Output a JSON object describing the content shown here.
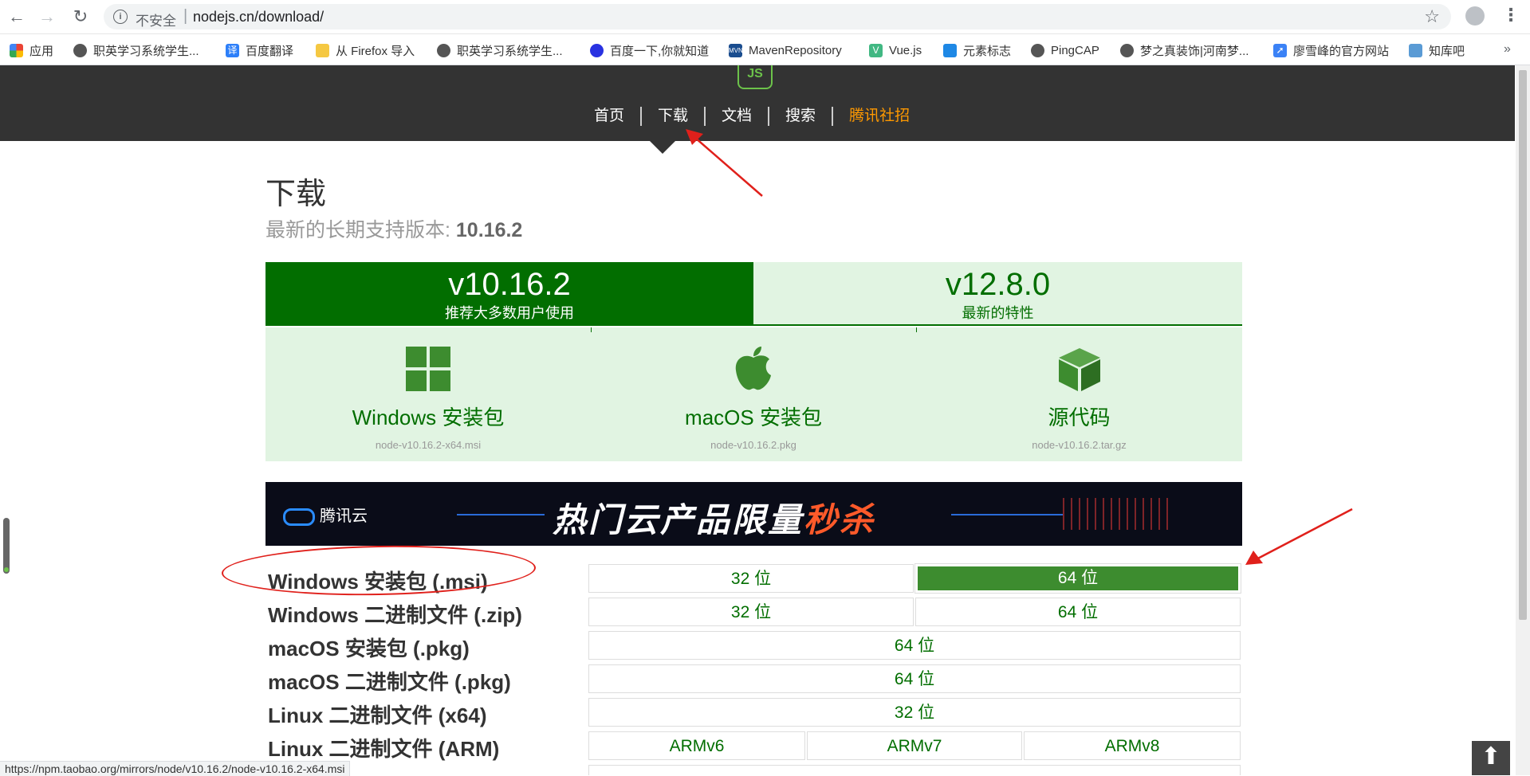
{
  "browser": {
    "insecure_label": "不安全",
    "url": "nodejs.cn/download/",
    "bookmarks": [
      {
        "label": "应用",
        "icon": "apps-grid-icon"
      },
      {
        "label": "职英学习系统学生...",
        "icon": "globe-icon"
      },
      {
        "label": "百度翻译",
        "icon": "translate-icon"
      },
      {
        "label": "从 Firefox 导入",
        "icon": "folder-icon"
      },
      {
        "label": "职英学习系统学生...",
        "icon": "globe-icon"
      },
      {
        "label": "百度一下,你就知道",
        "icon": "baidu-paw-icon"
      },
      {
        "label": "MavenRepository",
        "icon": "mvn-icon"
      },
      {
        "label": "Vue.js",
        "icon": "vue-icon"
      },
      {
        "label": "元素标志",
        "icon": "shield-icon"
      },
      {
        "label": "PingCAP",
        "icon": "globe-icon"
      },
      {
        "label": "梦之真装饰|河南梦...",
        "icon": "globe-icon"
      },
      {
        "label": "廖雪峰的官方网站",
        "icon": "rocket-icon"
      },
      {
        "label": "知库吧",
        "icon": "zhiku-icon"
      }
    ],
    "more_bookmarks": "»",
    "status_url": "https://npm.taobao.org/mirrors/node/v10.16.2/node-v10.16.2-x64.msi"
  },
  "site": {
    "logo_text": "JS",
    "nav": [
      "首页",
      "下载",
      "文档",
      "搜索",
      "腾讯社招"
    ],
    "title": "下载",
    "lts_prefix": "最新的长期支持版本: ",
    "lts_version": "10.16.2",
    "tabs": {
      "lts": {
        "version": "v10.16.2",
        "caption": "推荐大多数用户使用"
      },
      "current": {
        "version": "v12.8.0",
        "caption": "最新的特性"
      }
    },
    "downloads": [
      {
        "label": "Windows 安装包",
        "file": "node-v10.16.2-x64.msi",
        "icon": "windows-icon"
      },
      {
        "label": "macOS 安装包",
        "file": "node-v10.16.2.pkg",
        "icon": "apple-icon"
      },
      {
        "label": "源代码",
        "file": "node-v10.16.2.tar.gz",
        "icon": "box-icon"
      }
    ],
    "banner": {
      "brand": "腾讯云",
      "text_main": "热门云产品限量",
      "text_hot": "秒杀"
    },
    "table": [
      {
        "label": "Windows 安装包 (.msi)",
        "cells": [
          "32 位",
          "64 位"
        ]
      },
      {
        "label": "Windows 二进制文件 (.zip)",
        "cells": [
          "32 位",
          "64 位"
        ]
      },
      {
        "label": "macOS 安装包 (.pkg)",
        "cells": [
          "64 位"
        ]
      },
      {
        "label": "macOS 二进制文件 (.pkg)",
        "cells": [
          "64 位"
        ]
      },
      {
        "label": "Linux 二进制文件 (x64)",
        "cells": [
          "32 位"
        ]
      },
      {
        "label": "Linux 二进制文件 (ARM)",
        "cells": [
          "ARMv6",
          "ARMv7",
          "ARMv8"
        ]
      }
    ],
    "back_to_top": "⬆"
  }
}
